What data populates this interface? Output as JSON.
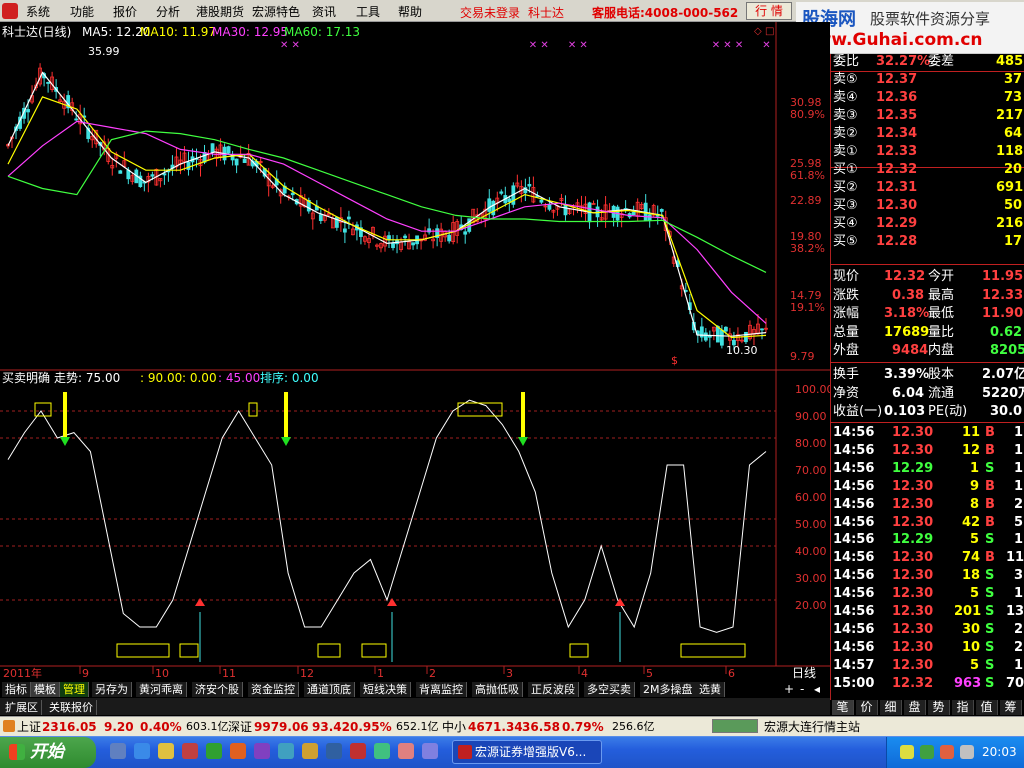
{
  "menu": {
    "items": [
      "系统",
      "功能",
      "报价",
      "分析",
      "港股期货",
      "宏源特色",
      "资讯",
      "工具",
      "帮助"
    ],
    "notice": "交易未登录",
    "stock": "科士达",
    "service": "客服电话:4008-000-562",
    "btn": "行 情"
  },
  "logo": {
    "main": "股海网",
    "sub": "股票软件资源分享",
    "url": "www.Guhai.com.cn"
  },
  "chart": {
    "title": "科士达(日线)",
    "ma": [
      "MA5: 12.20",
      "MA10: 11.97",
      "MA30: 12.95",
      "MA60: 17.13"
    ],
    "high_label": "35.99",
    "low_label": "10.30",
    "price_axis": [
      "30.98",
      "80.9%",
      "25.98",
      "61.8%",
      "22.89",
      "19.80",
      "38.2%",
      "14.79",
      "19.1%",
      "9.79"
    ],
    "indicator_line": [
      "买卖明确",
      "走势: 75.00",
      ": 90.00",
      ": 0.00",
      ": 45.00",
      "排序: 0.00"
    ],
    "ind_axis": [
      "100.00",
      "90.00",
      "80.00",
      "70.00",
      "60.00",
      "50.00",
      "40.00",
      "30.00",
      "20.00"
    ],
    "date_axis": [
      "2011年",
      "9",
      "10",
      "11",
      "12",
      "1",
      "2",
      "3",
      "4",
      "5",
      "6"
    ],
    "period": "日线"
  },
  "chart_data": [
    {
      "type": "line",
      "title": "科士达(日线)",
      "series": [
        {
          "name": "MA5",
          "values": [
            27.5,
            33.5,
            30,
            26.5,
            24.5,
            26,
            27,
            26.5,
            23.5,
            22,
            21,
            19.5,
            19.8,
            20.5,
            22.5,
            24,
            22.5,
            22,
            22.3,
            21.8,
            12,
            11.9,
            12.2
          ]
        },
        {
          "name": "MA10",
          "values": [
            26,
            31.5,
            30.5,
            27,
            25.5,
            25.5,
            26.5,
            26.8,
            24.2,
            22.5,
            21,
            19.8,
            19.8,
            20.5,
            22,
            23.5,
            22.8,
            22,
            22.2,
            21.8,
            14,
            11.8,
            11.97
          ]
        },
        {
          "name": "MA30",
          "values": [
            25,
            27.5,
            29.5,
            29,
            28.5,
            27.2,
            26.8,
            26.8,
            26,
            24.5,
            23,
            21.5,
            20.5,
            20.5,
            21.5,
            22.5,
            22.8,
            22.3,
            21.8,
            21.6,
            19,
            15.5,
            12.95
          ]
        },
        {
          "name": "MA60",
          "values": [
            25,
            24,
            23.5,
            28,
            28.7,
            28.5,
            28,
            27.2,
            26.5,
            25.5,
            24.5,
            23.5,
            22.5,
            21.8,
            21.5,
            21.5,
            21.3,
            21.3,
            21.3,
            21.4,
            20,
            18.5,
            17.13
          ]
        }
      ],
      "ylim": [
        9.79,
        36
      ]
    },
    {
      "type": "line",
      "title": "买卖明确",
      "series": [
        {
          "name": "走势",
          "values": [
            72,
            82,
            90,
            80,
            82,
            75,
            45,
            15,
            10,
            10,
            20,
            40,
            60,
            80,
            90,
            80,
            70,
            30,
            10,
            10,
            20,
            30,
            35,
            20,
            40,
            60,
            80,
            90,
            94,
            92,
            85,
            75,
            60,
            30,
            10,
            20,
            40,
            20,
            10,
            30,
            70,
            70,
            10,
            8,
            10,
            70,
            75
          ]
        }
      ],
      "ylim": [
        0,
        100
      ]
    }
  ],
  "right": {
    "rows": [
      {
        "k": "委比",
        "v": "32.27%",
        "k2": "委差",
        "v2": "485"
      },
      {
        "k": "卖⑤",
        "v": "12.37",
        "v2": "37"
      },
      {
        "k": "卖④",
        "v": "12.36",
        "v2": "73"
      },
      {
        "k": "卖③",
        "v": "12.35",
        "v2": "217"
      },
      {
        "k": "卖②",
        "v": "12.34",
        "v2": "64"
      },
      {
        "k": "卖①",
        "v": "12.33",
        "v2": "118"
      },
      {
        "k": "买①",
        "v": "12.32",
        "v2": "20"
      },
      {
        "k": "买②",
        "v": "12.31",
        "v2": "691"
      },
      {
        "k": "买③",
        "v": "12.30",
        "v2": "50"
      },
      {
        "k": "买④",
        "v": "12.29",
        "v2": "216"
      },
      {
        "k": "买⑤",
        "v": "12.28",
        "v2": "17"
      }
    ],
    "quotes": [
      {
        "k": "现价",
        "v": "12.32",
        "k2": "今开",
        "v2": "11.95"
      },
      {
        "k": "涨跌",
        "v": "0.38",
        "k2": "最高",
        "v2": "12.33"
      },
      {
        "k": "涨幅",
        "v": "3.18%",
        "k2": "最低",
        "v2": "11.90"
      },
      {
        "k": "总量",
        "v": "17689",
        "k2": "量比",
        "v2": "0.62"
      },
      {
        "k": "外盘",
        "v": "9484",
        "k2": "内盘",
        "v2": "8205"
      }
    ],
    "fund": [
      {
        "k": "换手",
        "v": "3.39%",
        "k2": "股本",
        "v2": "2.07亿"
      },
      {
        "k": "净资",
        "v": "6.04",
        "k2": "流通",
        "v2": "5220万"
      },
      {
        "k": "收益(一)",
        "v": "0.103",
        "k2": "PE(动)",
        "v2": "30.0"
      }
    ],
    "ticks": [
      {
        "t": "14:56",
        "p": "12.30",
        "v": "11",
        "s": "B",
        "n": "1"
      },
      {
        "t": "14:56",
        "p": "12.30",
        "v": "12",
        "s": "B",
        "n": "1"
      },
      {
        "t": "14:56",
        "p": "12.29",
        "v": "1",
        "s": "S",
        "n": "1"
      },
      {
        "t": "14:56",
        "p": "12.30",
        "v": "9",
        "s": "B",
        "n": "1"
      },
      {
        "t": "14:56",
        "p": "12.30",
        "v": "8",
        "s": "B",
        "n": "2"
      },
      {
        "t": "14:56",
        "p": "12.30",
        "v": "42",
        "s": "B",
        "n": "5"
      },
      {
        "t": "14:56",
        "p": "12.29",
        "v": "5",
        "s": "S",
        "n": "1"
      },
      {
        "t": "14:56",
        "p": "12.30",
        "v": "74",
        "s": "B",
        "n": "11"
      },
      {
        "t": "14:56",
        "p": "12.30",
        "v": "18",
        "s": "S",
        "n": "3"
      },
      {
        "t": "14:56",
        "p": "12.30",
        "v": "5",
        "s": "S",
        "n": "1"
      },
      {
        "t": "14:56",
        "p": "12.30",
        "v": "201",
        "s": "S",
        "n": "13"
      },
      {
        "t": "14:56",
        "p": "12.30",
        "v": "30",
        "s": "S",
        "n": "2"
      },
      {
        "t": "14:56",
        "p": "12.30",
        "v": "10",
        "s": "S",
        "n": "2"
      },
      {
        "t": "14:57",
        "p": "12.30",
        "v": "5",
        "s": "S",
        "n": "1"
      },
      {
        "t": "15:00",
        "p": "12.32",
        "v": "963",
        "s": "S",
        "n": "70"
      }
    ],
    "tabs": [
      "笔",
      "价",
      "细",
      "盘",
      "势",
      "指",
      "值",
      "筹"
    ]
  },
  "tabs": [
    "指标",
    "模板",
    "管理",
    "另存为",
    "黄河乖离",
    "济安个股",
    "资金监控",
    "通道顶底",
    "短线决策",
    "背离监控",
    "高抛低吸",
    "正反波段",
    "多空买卖",
    "2M多操盘",
    "选黄"
  ],
  "tabs2": [
    "扩展区",
    "关联报价"
  ],
  "status": {
    "sh": "上证",
    "sh_v": "2316.05",
    "sh_c": "9.20",
    "sh_p": "0.40%",
    "sh_a": "603.1亿",
    "sz": "深证",
    "sz_v": "9979.06",
    "sz_c": "93.42",
    "sz_p": "0.95%",
    "sz_a": "652.1亿",
    "zx": "中小",
    "zx_v": "4671.34",
    "zx_c": "36.58",
    "zx_p": "0.79%",
    "zx_a": "256.6亿",
    "site": "宏源大连行情主站"
  },
  "taskbar": {
    "start": "开始",
    "item": "宏源证券增强版V6...",
    "time": "20:03"
  }
}
